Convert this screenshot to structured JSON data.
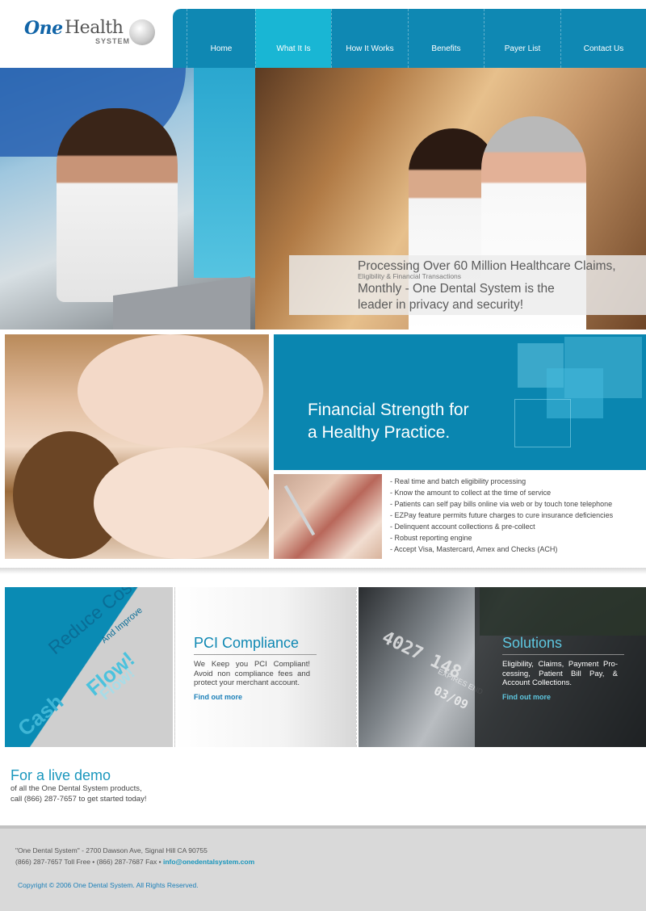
{
  "logo": {
    "one": "One",
    "health": "Health",
    "system": "SYSTEM"
  },
  "nav": [
    {
      "label": "Home",
      "active": false
    },
    {
      "label": "What It Is",
      "active": true
    },
    {
      "label": "How It Works",
      "active": false
    },
    {
      "label": "Benefits",
      "active": false
    },
    {
      "label": "Payer List",
      "active": false
    },
    {
      "label": "Contact Us",
      "active": false
    }
  ],
  "hero": {
    "caption_line1": "Processing Over 60 Million Healthcare Claims,",
    "caption_line2": "Eligibility & Financial Transactions",
    "caption_line3": "Monthly - One Dental System is the",
    "caption_line4": "leader in privacy and security!"
  },
  "strength": {
    "line1": "Financial Strength for",
    "line2": "a Healthy Practice."
  },
  "bullets": [
    "- Real time and batch eligibility processing",
    "- Know the amount to collect at the time of service",
    "- Patients can self pay bills online via web or by touch tone telephone",
    "- EZPay feature permits future charges to cure insurance deficiencies",
    "- Delinquent account collections & pre-collect",
    "- Robust reporting engine",
    "- Accept Visa, Mastercard, Amex and Checks (ACH)"
  ],
  "cashflow": {
    "reduce_cost": "Reduce Cost",
    "and_improve": "And Improve",
    "flow1": "Flow!",
    "flow2": "Flow!",
    "cash": "Cash"
  },
  "pci": {
    "title": "PCI Compliance",
    "body": "We Keep you PCI Compliant! Avoid non compliance fees and protect your merchant account.",
    "link": "Find out more"
  },
  "solutions": {
    "title": "Solutions",
    "body": "Eligibility, Claims, Payment Pro-cessing, Patient Bill Pay, & Account Collections.",
    "link": "Find out more",
    "card_number": "4027 148",
    "card_expires": "EXPIRES END",
    "card_date": "03/09"
  },
  "demo": {
    "title": "For a live demo",
    "line1": "of all the One Dental System products,",
    "line2": "call (866) 287-7657 to get started today!"
  },
  "footer": {
    "address": "\"One Dental System\" - 2700 Dawson Ave, Signal Hill CA 90755",
    "phones": "(866) 287-7657 Toll Free • (866) 287-7687 Fax • ",
    "email": "info@onedentalsystem.com",
    "copyright": "Copyright © 2006 One Dental System. All Rights Reserved."
  },
  "colors": {
    "brand_blue": "#0f88b3",
    "nav_active": "#19b6d4",
    "accent_teal": "#1a97bd",
    "footer_gray": "#d9d9d9"
  }
}
